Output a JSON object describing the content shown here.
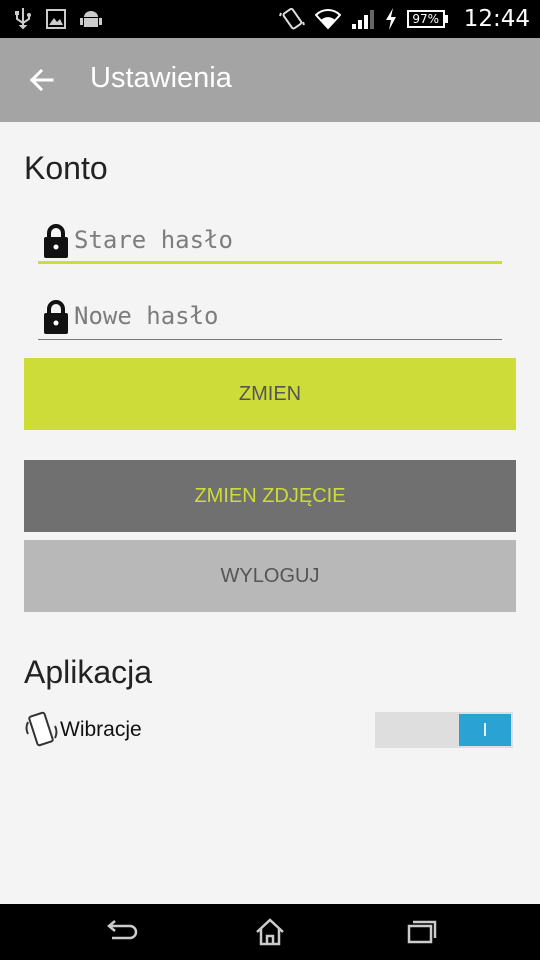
{
  "status_bar": {
    "time": "12:44",
    "battery": "97%",
    "left_icons": [
      "usb-icon",
      "image-icon",
      "android-icon"
    ],
    "right_icons": [
      "vibrate-icon",
      "wifi-icon",
      "signal-icon",
      "charging-icon",
      "battery-icon"
    ]
  },
  "app_bar": {
    "title": "Ustawienia",
    "back_icon": "arrow-left-icon"
  },
  "account": {
    "title": "Konto",
    "old_password_placeholder": "Stare hasło",
    "new_password_placeholder": "Nowe hasło",
    "change_button": "ZMIEN",
    "change_photo_button": "ZMIEN ZDJĘCIE",
    "logout_button": "WYLOGUJ"
  },
  "app_section": {
    "title": "Aplikacja",
    "vibration_label": "Wibracje",
    "vibration_toggle_label": "I",
    "vibration_enabled": true
  },
  "colors": {
    "accent": "#cddc39",
    "toggle_on": "#2aa3d4",
    "appbar": "#a4a4a4"
  }
}
